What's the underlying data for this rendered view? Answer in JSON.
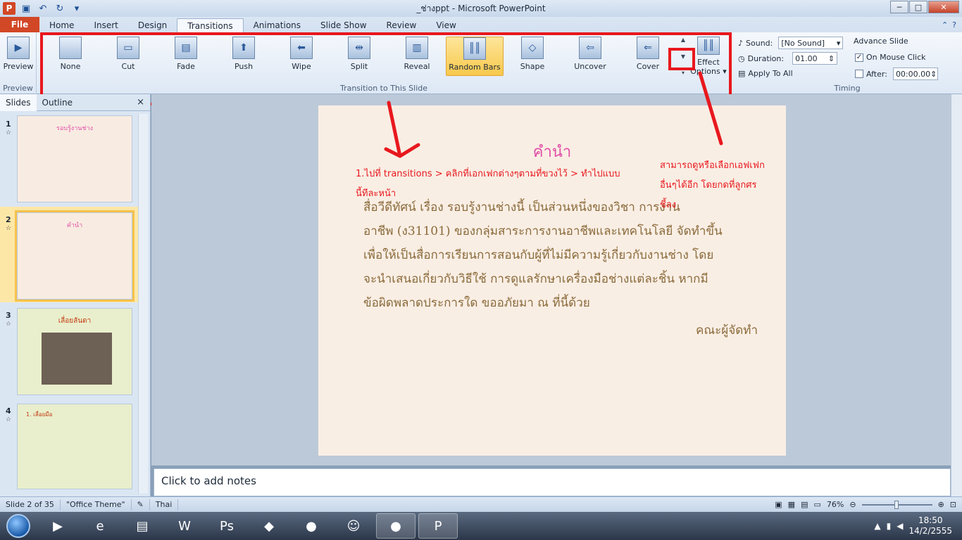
{
  "window": {
    "title": "_ช่างppt  -  Microsoft PowerPoint",
    "controls": {
      "minimize": "─",
      "maximize": "□",
      "close": "✕"
    }
  },
  "qat": {
    "app_icon": "P",
    "save": "💾",
    "undo": "↶",
    "redo": "↻",
    "customize": "▾"
  },
  "tabs": {
    "file": "File",
    "items": [
      "Home",
      "Insert",
      "Design",
      "Transitions",
      "Animations",
      "Slide Show",
      "Review",
      "View"
    ],
    "active": "Transitions"
  },
  "ribbon": {
    "preview": {
      "label": "Preview",
      "group": "Preview"
    },
    "transitions": [
      "None",
      "Cut",
      "Fade",
      "Push",
      "Wipe",
      "Split",
      "Reveal",
      "Random Bars",
      "Shape",
      "Uncover",
      "Cover"
    ],
    "selected_transition": "Random Bars",
    "effect_options_1": "Effect",
    "effect_options_2": "Options ▾",
    "group_transition": "Transition to This Slide",
    "timing": {
      "sound_label": "Sound:",
      "sound_value": "[No Sound]",
      "duration_label": "Duration:",
      "duration_value": "01.00",
      "apply_all": "Apply To All",
      "advance_label": "Advance Slide",
      "on_click_label": "On Mouse Click",
      "after_label": "After:",
      "after_value": "00:00.00",
      "group": "Timing"
    }
  },
  "pane": {
    "tab_slides": "Slides",
    "tab_outline": "Outline",
    "close": "×",
    "slides": [
      {
        "num": "1",
        "title": "รอบรู้งานช่าง"
      },
      {
        "num": "2",
        "title": "คำนำ"
      },
      {
        "num": "3",
        "title": "เลื่อยลันดา"
      },
      {
        "num": "4",
        "title": "1. เลื่อยมือ"
      }
    ]
  },
  "slide": {
    "title": "คำนำ",
    "body": [
      "สื่อวีดีทัศน์ เรื่อง รอบรู้งานช่างนี้ เป็นส่วนหนึ่งของวิชา การงาน",
      "อาชีพ (ง31101) ของกลุ่มสาระการงานอาชีพและเทคโนโลยี จัดทำขึ้น",
      "เพื่อให้เป็นสื่อการเรียนการสอนกับผู้ที่ไม่มีความรู้เกี่ยวกับงานช่าง โดย",
      "จะนำเสนอเกี่ยวกับวิธีใช้ การดูแลรักษาเครื่องมือช่างแต่ละชิ้น หากมี",
      "ข้อผิดพลาดประการใด ขออภัยมา ณ ที่นี้ด้วย"
    ],
    "sign": "คณะผู้จัดทำ"
  },
  "annotations": {
    "left_line1": "1.ไปที่ transitions > คลิกที่เอกเฟกต่างๆตามที่ขวงไว้   > ทำไปแบบ",
    "left_line2": "นี้ทีละหน้า",
    "right_line1": "สามารถดูหรือเลือกเอฟเฟก",
    "right_line2": "อื่นๆได้อีก   โดยกดที่ลูกศร",
    "right_line3": "ชี้ลง"
  },
  "notes": {
    "placeholder": "Click to add notes"
  },
  "status": {
    "slide_of": "Slide 2 of 35",
    "theme": "\"Office Theme\"",
    "language": "Thai",
    "zoom": "76%"
  },
  "taskbar": {
    "apps": [
      "media-player",
      "internet-explorer",
      "file-explorer",
      "word",
      "photoshop",
      "notepad",
      "firefox",
      "people",
      "firefox",
      "powerpoint"
    ],
    "time": "18:50",
    "date": "14/2/2555"
  },
  "colors": {
    "accent": "#d24726",
    "annotation": "#e8181e",
    "slide_title": "#e24ea8"
  }
}
